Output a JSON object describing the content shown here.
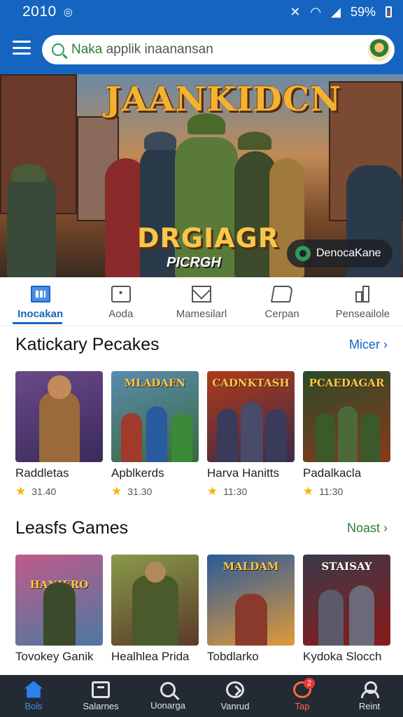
{
  "status_bar": {
    "time": "2010",
    "battery": "59%"
  },
  "search": {
    "highlight": "Naka",
    "placeholder": " applik inaanansan"
  },
  "hero": {
    "title": "JAANKIDCN",
    "subtitle": "DRGIAGR",
    "subtitle2": "PICRGH",
    "chip_label": "DenocaKane"
  },
  "tabs": [
    {
      "label": "Inocakan",
      "icon": "apps-icon",
      "active": true
    },
    {
      "label": "Aoda",
      "icon": "chat-icon",
      "active": false
    },
    {
      "label": "Mamesilarl",
      "icon": "mail-icon",
      "active": false
    },
    {
      "label": "Cerpan",
      "icon": "flag-icon",
      "active": false
    },
    {
      "label": "Penseailole",
      "icon": "chart-icon",
      "active": false
    }
  ],
  "sections": [
    {
      "title": "Katickary Pecakes",
      "more_label": "Micer",
      "cards": [
        {
          "name": "Raddletas",
          "rating": "31.40",
          "thumb_title": "",
          "colors": [
            "#6a4a8a",
            "#c98a3a"
          ]
        },
        {
          "name": "Apblkerds",
          "rating": "31.30",
          "thumb_title": "MLADAFN",
          "colors": [
            "#5a8ab0",
            "#3a6a3a"
          ]
        },
        {
          "name": "Harva Hanitts",
          "rating": "11:30",
          "thumb_title": "CADNKTASH",
          "colors": [
            "#b03a1a",
            "#3a2a4a"
          ]
        },
        {
          "name": "Padalkacla",
          "rating": "11:30",
          "thumb_title": "PCAEDAGAR",
          "colors": [
            "#2a4a2a",
            "#8a3a1a"
          ]
        }
      ]
    },
    {
      "title": "Leasfs Games",
      "more_label": "Noast",
      "cards": [
        {
          "name": "Tovokey Ganik",
          "rating": "",
          "thumb_title": "HANIERO",
          "colors": [
            "#c05a8a",
            "#4a7aa0"
          ]
        },
        {
          "name": "Healhlea Prida",
          "rating": "",
          "thumb_title": "",
          "colors": [
            "#8a9a4a",
            "#5a3a2a"
          ]
        },
        {
          "name": "Tobdlarko",
          "rating": "",
          "thumb_title": "MALDAM",
          "colors": [
            "#2a5a9a",
            "#e09a3a"
          ]
        },
        {
          "name": "Kydoka Slocch",
          "rating": "",
          "thumb_title": "STAISAY",
          "colors": [
            "#3a3a4a",
            "#8a1a1a"
          ]
        }
      ]
    }
  ],
  "bottom_nav": [
    {
      "label": "Bols",
      "icon": "home-icon"
    },
    {
      "label": "Salarnes",
      "icon": "box-icon"
    },
    {
      "label": "Uonarga",
      "icon": "search-icon"
    },
    {
      "label": "Vanrud",
      "icon": "compass-icon"
    },
    {
      "label": "Tap",
      "icon": "tap-icon",
      "badge": "2"
    },
    {
      "label": "Reint",
      "icon": "user-icon"
    }
  ]
}
